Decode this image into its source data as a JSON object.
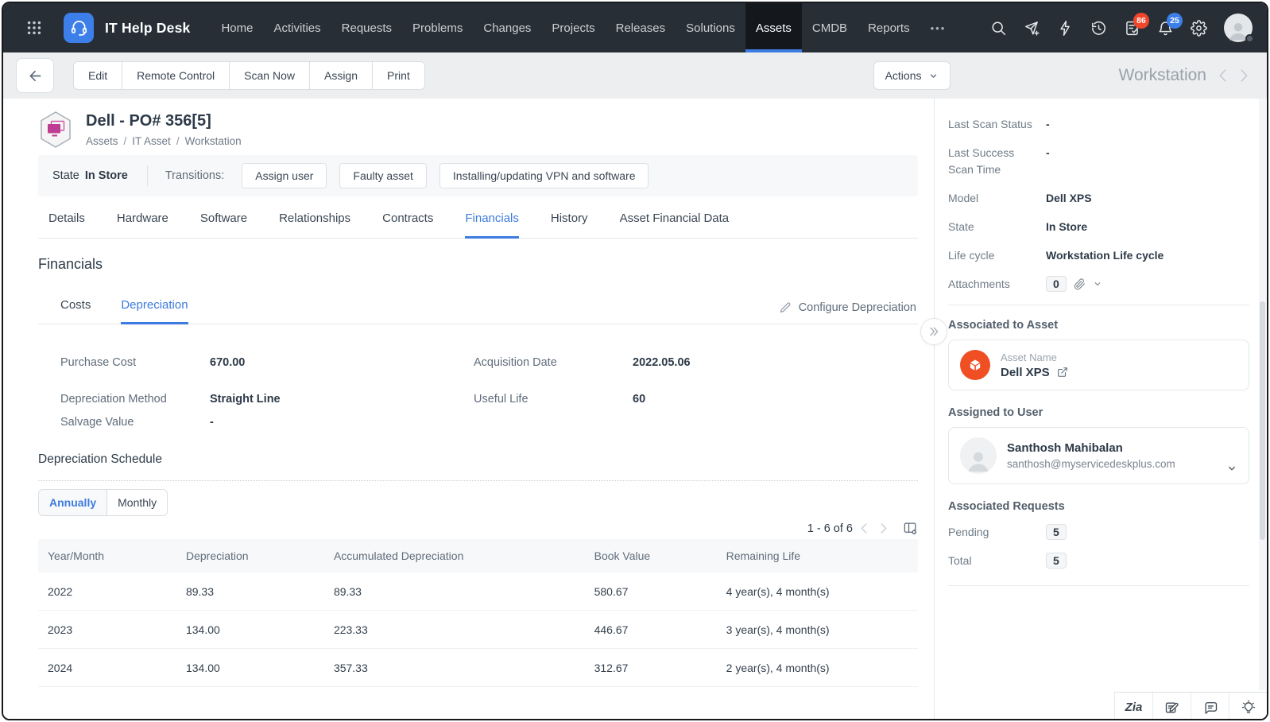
{
  "window": {
    "module_label": "Workstation"
  },
  "navbar": {
    "product": "IT Help Desk",
    "items": [
      "Home",
      "Activities",
      "Requests",
      "Problems",
      "Changes",
      "Projects",
      "Releases",
      "Solutions",
      "Assets",
      "CMDB",
      "Reports"
    ],
    "more_label": "•••",
    "tasks_badge": "86",
    "notifications_badge": "25"
  },
  "toolbar": {
    "buttons": [
      "Edit",
      "Remote Control",
      "Scan Now",
      "Assign",
      "Print"
    ],
    "actions_label": "Actions"
  },
  "asset_header": {
    "title": "Dell - PO# 356[5]",
    "breadcrumb": [
      "Assets",
      "IT Asset",
      "Workstation"
    ]
  },
  "state_bar": {
    "state_label": "State",
    "state_value": "In Store",
    "transitions_label": "Transitions:",
    "transitions": [
      "Assign user",
      "Faulty asset",
      "Installing/updating VPN and software"
    ]
  },
  "tabs": [
    "Details",
    "Hardware",
    "Software",
    "Relationships",
    "Contracts",
    "Financials",
    "History",
    "Asset Financial Data"
  ],
  "financials": {
    "heading": "Financials",
    "subtab_costs": "Costs",
    "subtab_depreciation": "Depreciation",
    "configure_label": "Configure Depreciation",
    "fields": [
      {
        "label": "Purchase Cost",
        "value": "670.00"
      },
      {
        "label": "Acquisition Date",
        "value": "2022.05.06"
      },
      {
        "label": "Depreciation Method",
        "value": "Straight Line"
      },
      {
        "label": "Useful Life",
        "value": "60"
      },
      {
        "label": "Salvage Value",
        "value": "-"
      }
    ]
  },
  "schedule": {
    "heading": "Depreciation Schedule",
    "toggle_annually": "Annually",
    "toggle_monthly": "Monthly",
    "pagination": "1 - 6 of 6",
    "columns": [
      "Year/Month",
      "Depreciation",
      "Accumulated Depreciation",
      "Book Value",
      "Remaining Life"
    ],
    "rows": [
      [
        "2022",
        "89.33",
        "89.33",
        "580.67",
        "4 year(s), 4 month(s)"
      ],
      [
        "2023",
        "134.00",
        "223.33",
        "446.67",
        "3 year(s), 4 month(s)"
      ],
      [
        "2024",
        "134.00",
        "357.33",
        "312.67",
        "2 year(s), 4 month(s)"
      ]
    ]
  },
  "sidebar": {
    "fields": [
      {
        "label": "Last Scan Status",
        "value": "-"
      },
      {
        "label": "Last Success Scan Time",
        "value": "-"
      },
      {
        "label": "Model",
        "value": "Dell XPS"
      },
      {
        "label": "State",
        "value": "In Store"
      },
      {
        "label": "Life cycle",
        "value": "Workstation Life cycle"
      }
    ],
    "attachments_label": "Attachments",
    "attachments_count": "0",
    "associated_asset": {
      "heading": "Associated to Asset",
      "field_label": "Asset Name",
      "value": "Dell XPS"
    },
    "assigned_user": {
      "heading": "Assigned to User",
      "name": "Santhosh Mahibalan",
      "email": "santhosh@myservicedeskplus.com"
    },
    "associated_requests": {
      "heading": "Associated Requests",
      "pending_label": "Pending",
      "pending_count": "5",
      "total_label": "Total",
      "total_count": "5"
    }
  },
  "footer": {
    "zia_label": "Zia"
  },
  "colors": {
    "accent_blue": "#3D7BE0",
    "navbar_bg": "#272E36",
    "badge_red": "#F1462C",
    "badge_blue": "#3D7FE8",
    "brand_orange": "#F04E23",
    "asset_icon_magenta": "#BE3D92"
  }
}
